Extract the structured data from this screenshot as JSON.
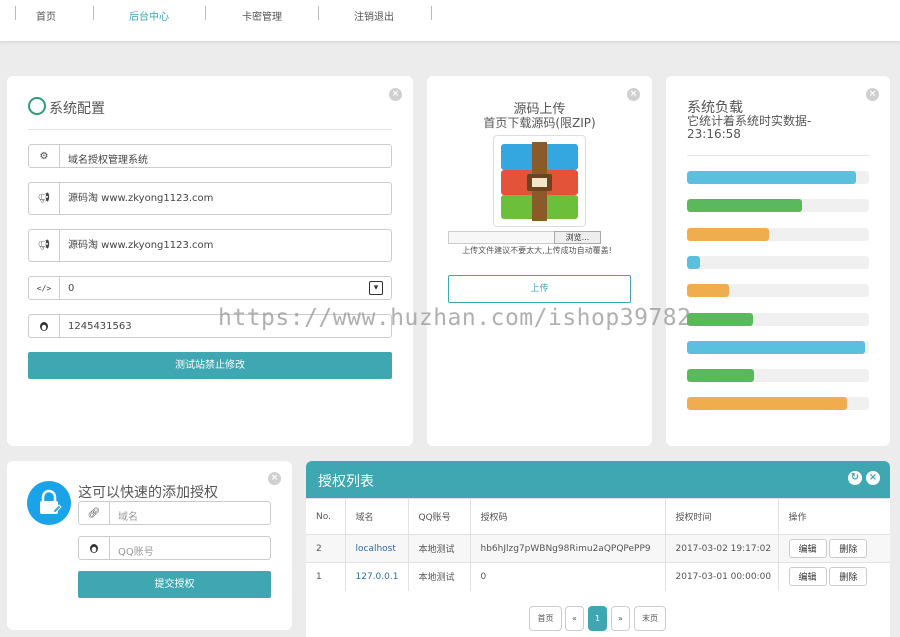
{
  "nav": [
    "首页",
    "后台中心",
    "卡密管理",
    "注销退出"
  ],
  "config": {
    "title": "系统配置",
    "site_name": "域名授权管理系统",
    "notice1": "源码淘 www.zkyong1123.com",
    "notice2": "源码淘 www.zkyong1123.com",
    "select_value": "0",
    "qq": "1245431563",
    "submit": "测试站禁止修改"
  },
  "upload": {
    "title": "源码上传",
    "subtitle": "首页下载源码(限ZIP)",
    "browse": "浏览...",
    "hint": "上传文件建议不要太大,上传成功自动覆盖!",
    "button": "上传"
  },
  "load": {
    "title": "系统负载",
    "subtitle_line1": "它统计着系统时实数据-",
    "subtitle_line2": "23:16:58",
    "bars": [
      {
        "value": 0.93,
        "color": "#5bc0de"
      },
      {
        "value": 0.63,
        "color": "#5cb85c"
      },
      {
        "value": 0.45,
        "color": "#f0ad4e"
      },
      {
        "value": 0.07,
        "color": "#5bc0de"
      },
      {
        "value": 0.23,
        "color": "#f0ad4e"
      },
      {
        "value": 0.36,
        "color": "#5cb85c"
      },
      {
        "value": 0.98,
        "color": "#5bc0de"
      },
      {
        "value": 0.37,
        "color": "#5cb85c"
      },
      {
        "value": 0.88,
        "color": "#f0ad4e"
      }
    ]
  },
  "quick_add": {
    "title": "这可以快速的添加授权",
    "domain_placeholder": "域名",
    "qq_placeholder": "QQ账号",
    "submit": "提交授权"
  },
  "auth_list": {
    "title": "授权列表",
    "headers": [
      "No.",
      "域名",
      "QQ账号",
      "授权码",
      "授权时间",
      "操作"
    ],
    "rows": [
      {
        "no": "2",
        "domain": "localhost",
        "qq": "本地测试",
        "code": "hb6hJlzg7pWBNg98Rimu2aQPQPePP9",
        "time": "2017-03-02 19:17:02"
      },
      {
        "no": "1",
        "domain": "127.0.0.1",
        "qq": "本地测试",
        "code": "0",
        "time": "2017-03-01 00:00:00"
      }
    ],
    "edit_label": "编辑",
    "delete_label": "删除"
  },
  "pagination": {
    "first": "首页",
    "prev": "«",
    "current": "1",
    "next": "»",
    "last": "末页"
  },
  "watermark": "https://www.huzhan.com/ishop39782",
  "colors": {
    "accent": "#3ea7b1",
    "link": "#2e6da4"
  }
}
